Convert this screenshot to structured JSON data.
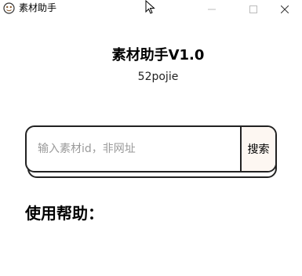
{
  "window": {
    "title": "素材助手"
  },
  "header": {
    "title": "素材助手V1.0",
    "subtitle": "52pojie"
  },
  "search": {
    "placeholder": "输入素材id，非网址",
    "value": "",
    "button_label": "搜索"
  },
  "help": {
    "heading": "使用帮助："
  }
}
